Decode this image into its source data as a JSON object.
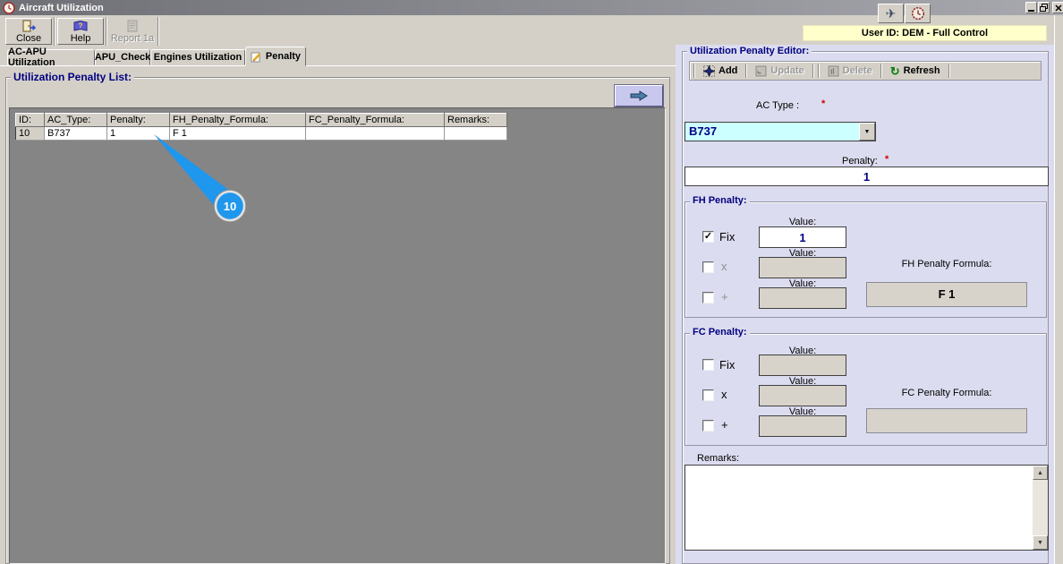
{
  "window": {
    "title": "Aircraft Utilization"
  },
  "header": {
    "user_id": "User ID: DEM - Full Control"
  },
  "app_toolbar": {
    "close": "Close",
    "help": "Help",
    "report": "Report 1a"
  },
  "tabs": [
    {
      "label": "AC-APU Utilization"
    },
    {
      "label": "APU_Check"
    },
    {
      "label": "Engines Utilization"
    },
    {
      "label": "Penalty"
    }
  ],
  "list_panel": {
    "title": "Utilization Penalty List:",
    "table": {
      "headers": [
        "ID:",
        "AC_Type:",
        "Penalty:",
        "FH_Penalty_Formula:",
        "FC_Penalty_Formula:",
        "Remarks:"
      ],
      "rows": [
        [
          "10",
          "B737",
          "1",
          "F 1",
          "",
          ""
        ]
      ]
    },
    "callout_label": "10"
  },
  "editor": {
    "title": "Utilization Penalty Editor:",
    "toolbar": {
      "add": "Add",
      "update": "Update",
      "delete": "Delete",
      "refresh": "Refresh",
      "refresh_icon": "↻"
    },
    "required_mark": "*",
    "value_label": "Value:",
    "check_glyph": "✓",
    "ac_type": {
      "label": "AC Type :",
      "value": "B737"
    },
    "penalty": {
      "label": "Penalty:",
      "value": "1"
    },
    "fh": {
      "title": "FH Penalty:",
      "fix_label": "Fix",
      "x_label": "x",
      "plus_label": "+",
      "fix_value": "1",
      "x_value": "",
      "plus_value": "",
      "formula_label": "FH Penalty Formula:",
      "formula_value": "F 1"
    },
    "fc": {
      "title": "FC Penalty:",
      "fix_label": "Fix",
      "x_label": "x",
      "plus_label": "+",
      "fix_value": "",
      "x_value": "",
      "plus_value": "",
      "formula_label": "FC Penalty Formula:",
      "formula_value": ""
    },
    "remarks": {
      "label": "Remarks:",
      "value": ""
    }
  },
  "colors": {
    "accent_blue": "#1f97ed",
    "combo_bg": "#ccffff",
    "user_bar_bg": "#ffffcc",
    "navy": "#000080",
    "list_bg": "#858585",
    "panel_bg": "#dcdcf0"
  }
}
